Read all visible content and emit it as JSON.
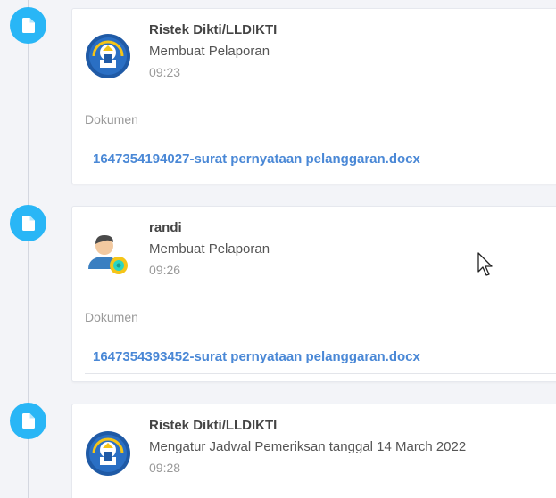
{
  "timeline": {
    "entries": [
      {
        "author": "Ristek Dikti/LLDIKTI",
        "action": "Membuat Pelaporan",
        "time": "09:23",
        "avatar_icon": "ristekdikti-logo",
        "documents_label": "Dokumen",
        "document": "1647354194027-surat pernyataan pelanggaran.docx"
      },
      {
        "author": "randi",
        "action": "Membuat Pelaporan",
        "time": "09:26",
        "avatar_icon": "user-gear-avatar",
        "documents_label": "Dokumen",
        "document": "1647354393452-surat pernyataan pelanggaran.docx"
      },
      {
        "author": "Ristek Dikti/LLDIKTI",
        "action": "Mengatur Jadwal Pemeriksan tanggal 14 March 2022",
        "time": "09:28",
        "avatar_icon": "ristekdikti-logo"
      }
    ],
    "badge_icon": "file-icon"
  },
  "colors": {
    "badge": "#29b6f6",
    "link": "#4a88d6",
    "background": "#f3f4f8"
  }
}
